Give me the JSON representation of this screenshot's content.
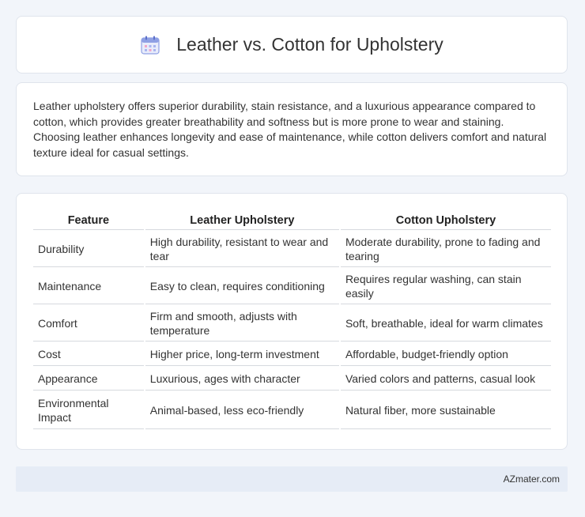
{
  "header": {
    "title": "Leather vs. Cotton for Upholstery",
    "icon": "calendar-icon"
  },
  "intro": {
    "text": "Leather upholstery offers superior durability, stain resistance, and a luxurious appearance compared to cotton, which provides greater breathability and softness but is more prone to wear and staining. Choosing leather enhances longevity and ease of maintenance, while cotton delivers comfort and natural texture ideal for casual settings."
  },
  "table": {
    "headers": [
      "Feature",
      "Leather Upholstery",
      "Cotton Upholstery"
    ],
    "rows": [
      [
        "Durability",
        "High durability, resistant to wear and tear",
        "Moderate durability, prone to fading and tearing"
      ],
      [
        "Maintenance",
        "Easy to clean, requires conditioning",
        "Requires regular washing, can stain easily"
      ],
      [
        "Comfort",
        "Firm and smooth, adjusts with temperature",
        "Soft, breathable, ideal for warm climates"
      ],
      [
        "Cost",
        "Higher price, long-term investment",
        "Affordable, budget-friendly option"
      ],
      [
        "Appearance",
        "Luxurious, ages with character",
        "Varied colors and patterns, casual look"
      ],
      [
        "Environmental Impact",
        "Animal-based, less eco-friendly",
        "Natural fiber, more sustainable"
      ]
    ]
  },
  "footer": {
    "brand": "AZmater.com"
  },
  "colors": {
    "background": "#f2f5fa",
    "card": "#ffffff",
    "footer": "#e6ecf6",
    "icon_accent": "#7b8fe0"
  }
}
